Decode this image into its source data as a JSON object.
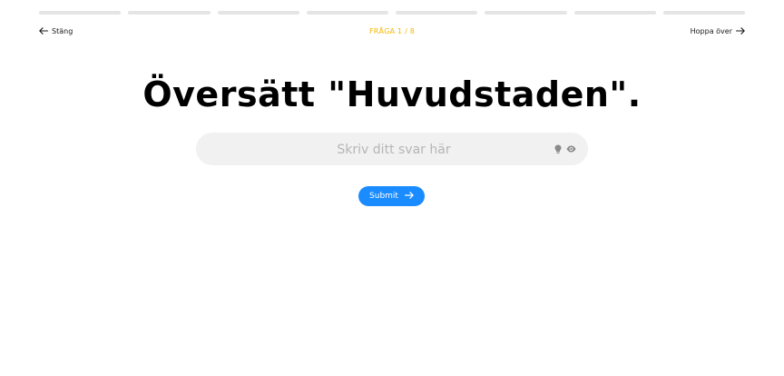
{
  "progress": {
    "total_segments": 8,
    "completed_segments": 0,
    "track_color": "#e5e5e5"
  },
  "header": {
    "close_label": "Stäng",
    "counter_text": "FRÅGA 1 / 8",
    "counter_color": "#f2b705",
    "skip_label": "Hoppa över"
  },
  "question": {
    "title": "Översätt \"Huvudstaden\"."
  },
  "answer": {
    "placeholder": "Skriv ditt svar här",
    "value": "",
    "hint_icon": "lightbulb-icon",
    "reveal_icon": "eye-icon"
  },
  "submit": {
    "label": "Submit",
    "color": "#1a8cff"
  }
}
